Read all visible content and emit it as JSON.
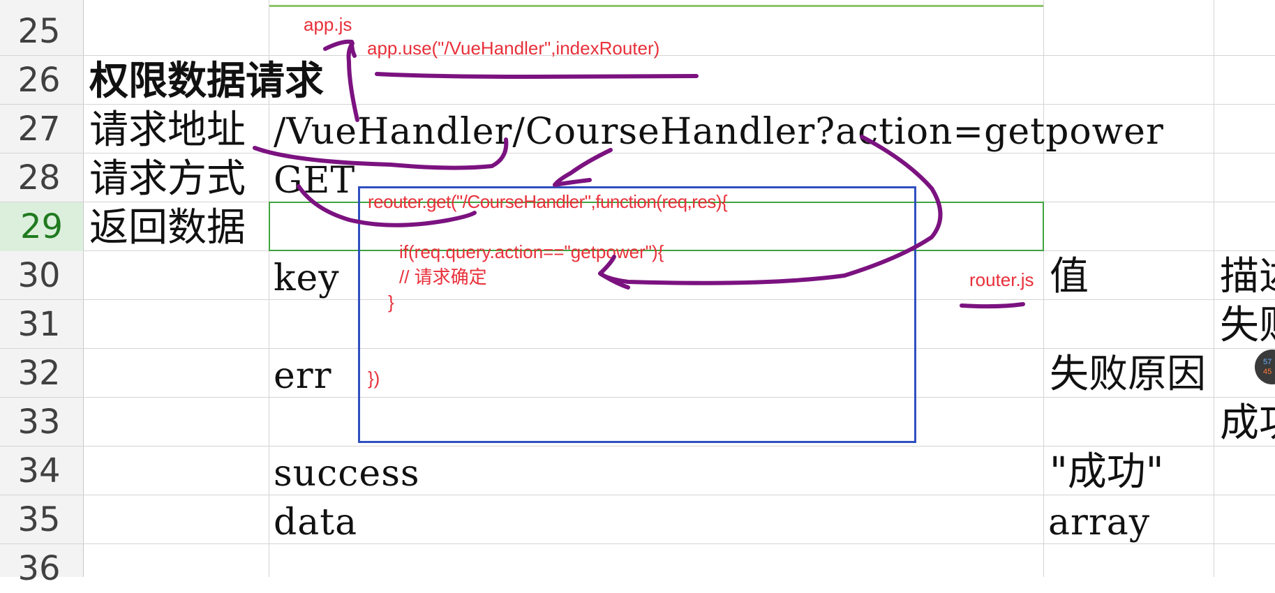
{
  "rows": [
    {
      "num": "25"
    },
    {
      "num": "26"
    },
    {
      "num": "27"
    },
    {
      "num": "28"
    },
    {
      "num": "29",
      "active": true
    },
    {
      "num": "30"
    },
    {
      "num": "31"
    },
    {
      "num": "32"
    },
    {
      "num": "33"
    },
    {
      "num": "34"
    },
    {
      "num": "35"
    },
    {
      "num": "36"
    }
  ],
  "cells": {
    "r26_title": "权限数据请求",
    "r27_label": "请求地址",
    "r27_value": "/VueHandler/CourseHandler?action=getpower",
    "r28_label": "请求方式",
    "r28_value": "GET",
    "r29_label": "返回数据",
    "r30_key": "key",
    "r30_value": "值",
    "r30_desc": "描述",
    "r31_desc": "失败",
    "r32_key": "err",
    "r32_value": "失败原因",
    "r33_desc": "成功",
    "r34_key": "success",
    "r34_value": "\"成功\"",
    "r35_key": "data",
    "r35_value": "array"
  },
  "annotations": {
    "app_js": "app.js",
    "app_use": "app.use(\"/VueHandler\",indexRouter)",
    "router_get": "reouter.get(\"/CourseHandler\",function(req,res){",
    "if_line": "if(req.query.action==\"getpower\"){",
    "comment_line": "// 请求确定",
    "close_brace": "}",
    "close_call": "})",
    "router_js": "router.js"
  },
  "overlay": {
    "upload": "57",
    "download": "45"
  },
  "colors": {
    "annotation_red": "#e8303a",
    "ink_purple": "#7b1280",
    "box_blue": "#2f4fbf",
    "selection_green": "#3fa33f"
  }
}
